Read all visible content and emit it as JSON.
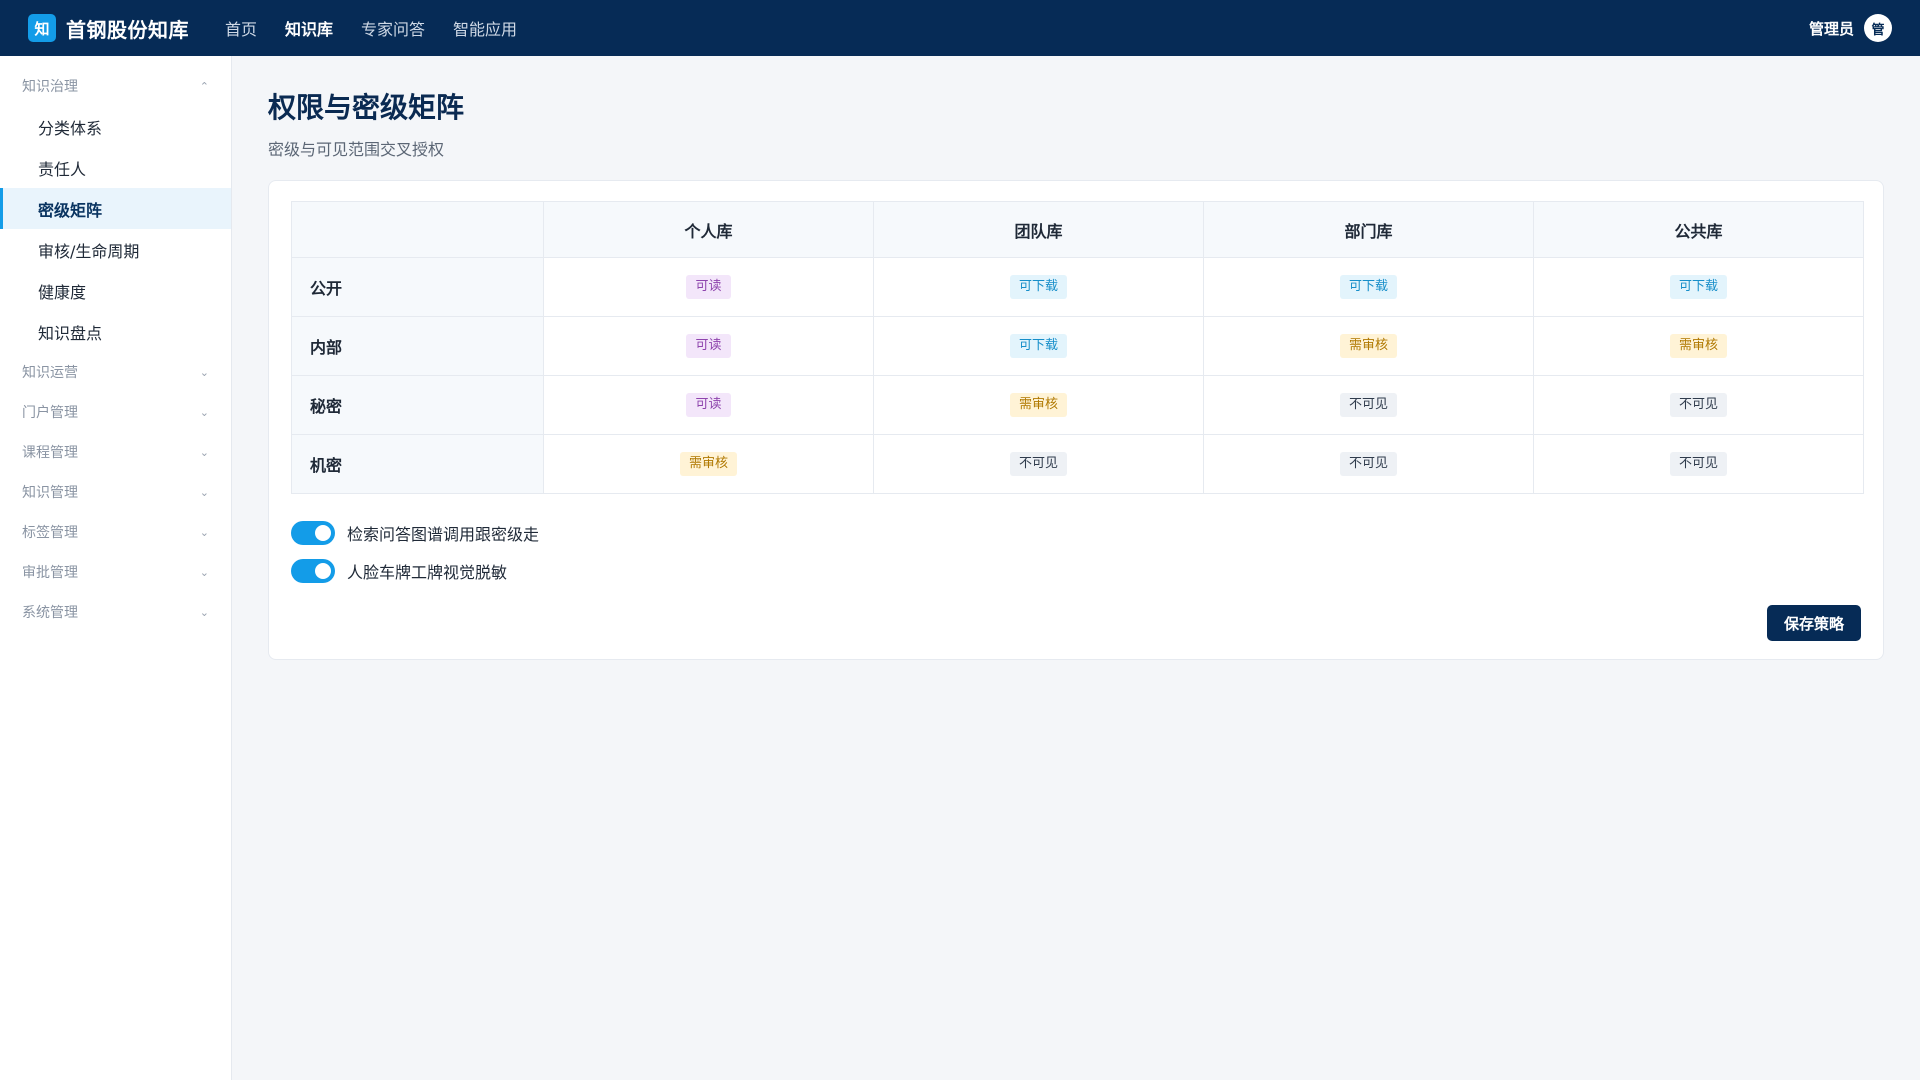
{
  "header": {
    "logo_char": "知",
    "brand": "首钢股份知库",
    "nav": [
      {
        "label": "首页",
        "active": false
      },
      {
        "label": "知识库",
        "active": true
      },
      {
        "label": "专家问答",
        "active": false
      },
      {
        "label": "智能应用",
        "active": false
      }
    ],
    "user_name": "管理员",
    "avatar_char": "管"
  },
  "sidebar": {
    "groups": [
      {
        "label": "知识治理",
        "expanded": true,
        "chevron": "⌃",
        "items": [
          {
            "label": "分类体系",
            "active": false
          },
          {
            "label": "责任人",
            "active": false
          },
          {
            "label": "密级矩阵",
            "active": true
          },
          {
            "label": "审核/生命周期",
            "active": false
          },
          {
            "label": "健康度",
            "active": false
          },
          {
            "label": "知识盘点",
            "active": false
          }
        ]
      },
      {
        "label": "知识运营",
        "expanded": false,
        "chevron": "⌄"
      },
      {
        "label": "门户管理",
        "expanded": false,
        "chevron": "⌄"
      },
      {
        "label": "课程管理",
        "expanded": false,
        "chevron": "⌄"
      },
      {
        "label": "知识管理",
        "expanded": false,
        "chevron": "⌄"
      },
      {
        "label": "标签管理",
        "expanded": false,
        "chevron": "⌄"
      },
      {
        "label": "审批管理",
        "expanded": false,
        "chevron": "⌄"
      },
      {
        "label": "系统管理",
        "expanded": false,
        "chevron": "⌄"
      }
    ]
  },
  "main": {
    "title": "权限与密级矩阵",
    "subtitle": "密级与可见范围交叉授权",
    "matrix": {
      "corner": "",
      "columns": [
        "个人库",
        "团队库",
        "部门库",
        "公共库"
      ],
      "rows": [
        {
          "label": "公开",
          "cells": [
            {
              "text": "可读",
              "kind": "read"
            },
            {
              "text": "可下载",
              "kind": "download"
            },
            {
              "text": "可下载",
              "kind": "download"
            },
            {
              "text": "可下载",
              "kind": "download"
            }
          ]
        },
        {
          "label": "内部",
          "cells": [
            {
              "text": "可读",
              "kind": "read"
            },
            {
              "text": "可下载",
              "kind": "download"
            },
            {
              "text": "需审核",
              "kind": "review"
            },
            {
              "text": "需审核",
              "kind": "review"
            }
          ]
        },
        {
          "label": "秘密",
          "cells": [
            {
              "text": "可读",
              "kind": "read"
            },
            {
              "text": "需审核",
              "kind": "review"
            },
            {
              "text": "不可见",
              "kind": "hidden"
            },
            {
              "text": "不可见",
              "kind": "hidden"
            }
          ]
        },
        {
          "label": "机密",
          "cells": [
            {
              "text": "需审核",
              "kind": "review"
            },
            {
              "text": "不可见",
              "kind": "hidden"
            },
            {
              "text": "不可见",
              "kind": "hidden"
            },
            {
              "text": "不可见",
              "kind": "hidden"
            }
          ]
        }
      ]
    },
    "toggles": [
      {
        "label": "检索问答图谱调用跟密级走",
        "on": true
      },
      {
        "label": "人脸车牌工牌视觉脱敏",
        "on": true
      }
    ],
    "save_label": "保存策略"
  },
  "colors": {
    "topbar": "#062b56",
    "accent": "#139ce8",
    "read_tag": "#8e44ad",
    "download_tag": "#168ec9",
    "review_tag": "#b07800",
    "hidden_tag": "#2f3b4c"
  }
}
